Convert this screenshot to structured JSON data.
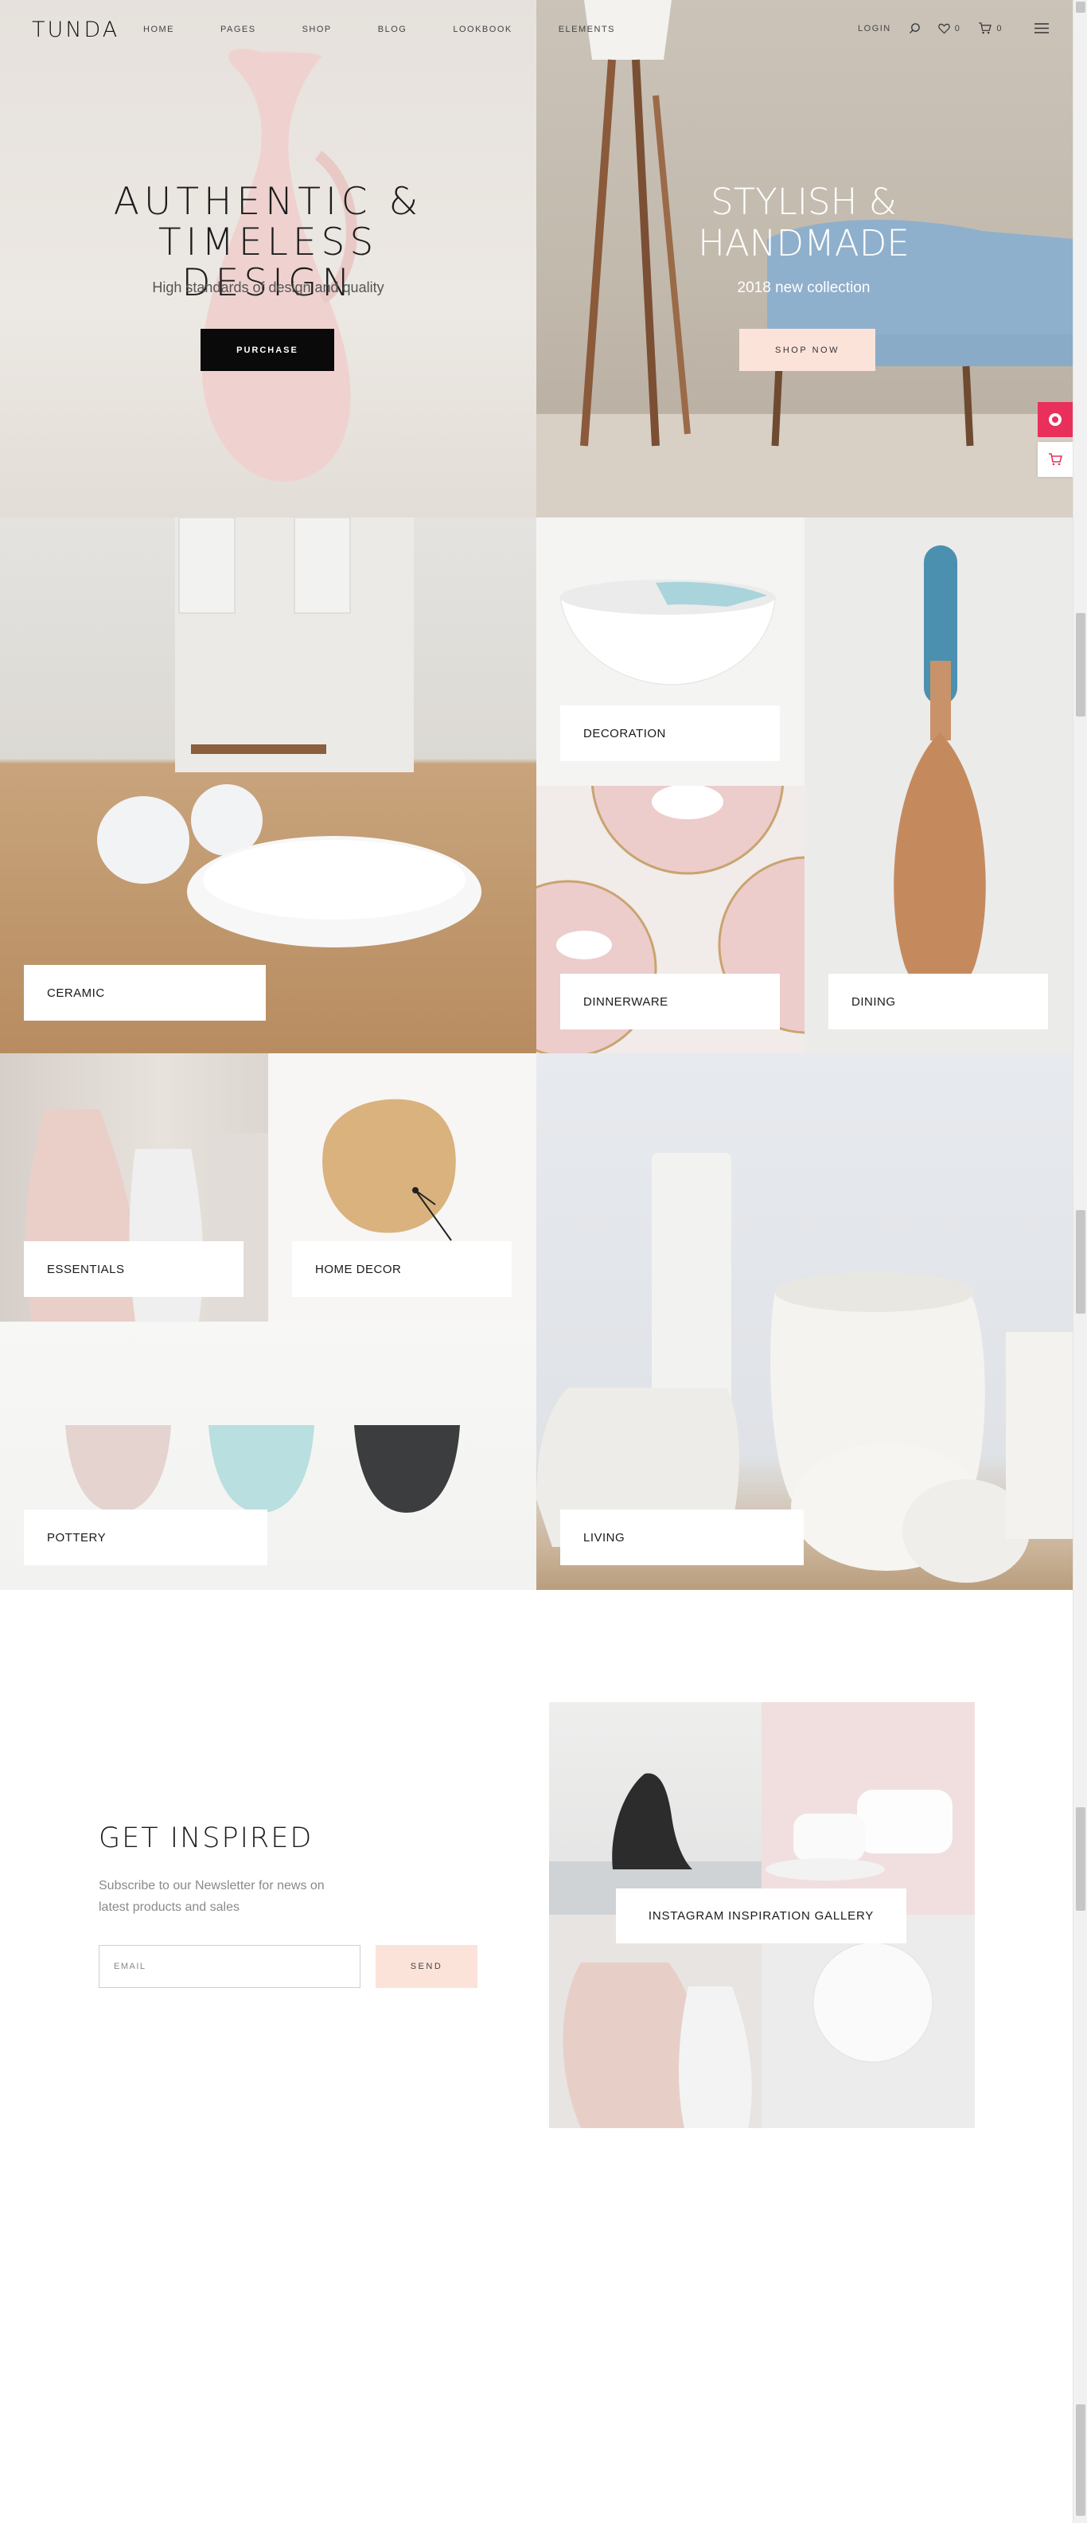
{
  "brand": {
    "logo": "TUNDA"
  },
  "nav": {
    "items": [
      "HOME",
      "PAGES",
      "SHOP",
      "BLOG",
      "LOOKBOOK",
      "ELEMENTS"
    ]
  },
  "header_tools": {
    "login": "LOGIN",
    "wishlist_count": "0",
    "cart_count": "0"
  },
  "hero": {
    "left": {
      "title": "AUTHENTIC & TIMELESS DESIGN",
      "subtitle": "High standards of design and quality",
      "button": "PURCHASE"
    },
    "right": {
      "title": "STYLISH & HANDMADE",
      "subtitle": "2018 new collection",
      "button": "SHOP NOW"
    }
  },
  "categories": {
    "ceramic": "CERAMIC",
    "decoration": "DECORATION",
    "dinnerware": "DINNERWARE",
    "dining": "DINING",
    "essentials": "ESSENTIALS",
    "home_decor": "HOME DECOR",
    "pottery": "POTTERY",
    "living": "LIVING"
  },
  "newsletter": {
    "title": "GET INSPIRED",
    "description": "Subscribe to our Newsletter for news on latest products and sales",
    "placeholder": "EMAIL",
    "button": "SEND"
  },
  "instagram": {
    "label": "INSTAGRAM INSPIRATION GALLERY"
  },
  "colors": {
    "accent_pink": "#fbe3da",
    "dark": "#0a0a0a",
    "badge_red": "#e8305b"
  }
}
